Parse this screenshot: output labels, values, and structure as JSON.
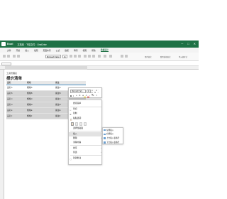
{
  "titlebar": {
    "app_name": "Excel",
    "file_name": "文档库 · 下载文件 · OneDrive",
    "minimize": "─",
    "maximize": "□",
    "close": "✕"
  },
  "menu": {
    "items": [
      "文件",
      "开始",
      "插入",
      "绘图",
      "页面布局",
      "公式",
      "数据",
      "审阅",
      "视图",
      "帮助",
      "表格设计"
    ],
    "active_index": 10
  },
  "ribbon": {
    "font": "Microsoft Yahei",
    "size": "11",
    "right_labels": [
      "条件格式",
      "套用表格格式",
      "单元格样式"
    ]
  },
  "sheet": {
    "breadcrumb": "工资管理表",
    "title": "报价清单",
    "table": {
      "headers": [
        "品名",
        "规格",
        "备注"
      ],
      "rows": [
        {
          "c1": "品名A",
          "c2": "规格A",
          "c3": "备注A"
        },
        {
          "c1": "品名B",
          "c2": "规格B",
          "c3": "备注B"
        },
        {
          "c1": "品名C",
          "c2": "规格C",
          "c3": "备注C"
        },
        {
          "c1": "品名D",
          "c2": "规格D",
          "c3": "备注D"
        },
        {
          "c1": "品名E",
          "c2": "规格E",
          "c3": "备注E"
        },
        {
          "c1": "品名F",
          "c2": "规格F",
          "c3": "备注F"
        }
      ]
    }
  },
  "mini_toolbar": {
    "font": "Microsoft Yah...",
    "size": "11",
    "top_icons": "A⁺ A⁻ $ % ⁘ ▦",
    "bold": "B",
    "italic": "I",
    "bottom_icons": "≡ ⊞ ◈ A ↔ ⇲ ✎"
  },
  "context_menu": {
    "search": "搜索菜单",
    "items": [
      "剪切",
      "复制",
      "粘贴选项:",
      "选择性粘贴",
      "插入",
      "删除",
      "清除内容",
      "排序",
      "筛选",
      "新建批注"
    ],
    "submenu_arrow": "›"
  },
  "submenu": {
    "items": [
      "左侧插入",
      "右侧插入",
      "上方插入表格行",
      "下方插入表格行"
    ]
  }
}
